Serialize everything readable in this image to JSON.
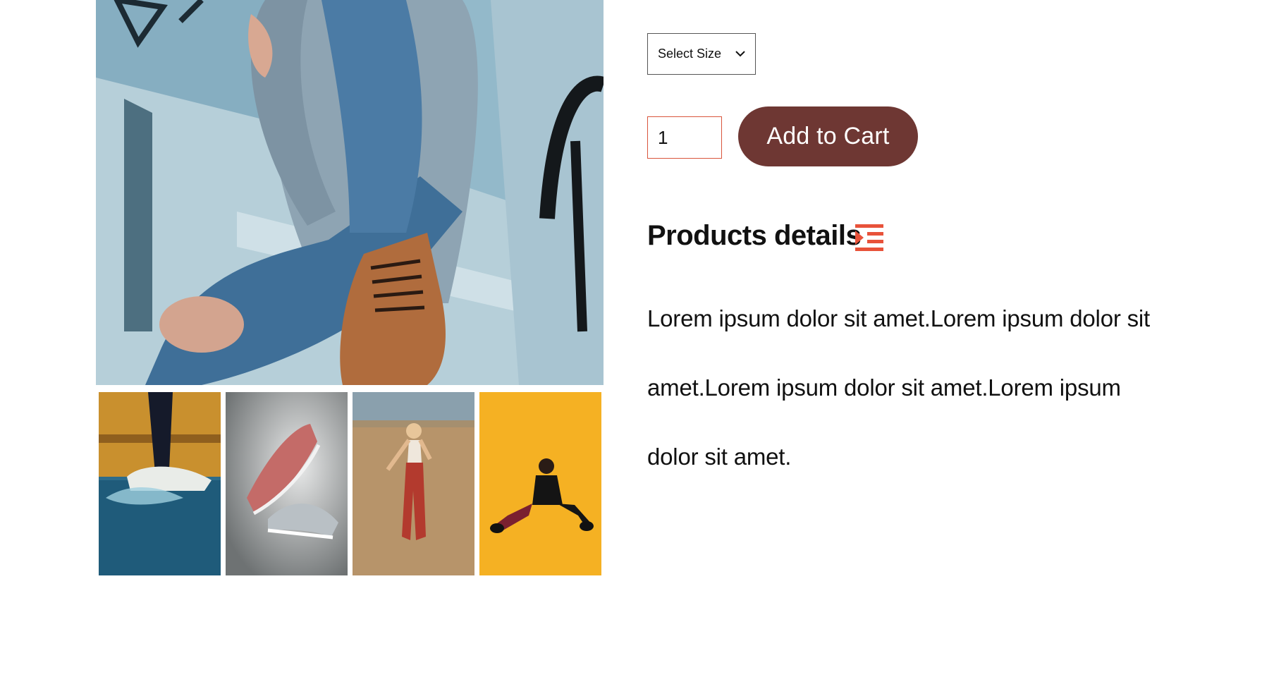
{
  "product": {
    "size_select": {
      "selected": "Select Size"
    },
    "quantity": {
      "value": "1"
    },
    "add_to_cart_label": "Add to Cart",
    "details_title": "Products details",
    "details_icon": "indent-list-icon",
    "description": "Lorem ipsum dolor sit amet.Lorem ipsum dolor sit amet.Lorem ipsum dolor sit amet.Lorem ipsum dolor sit amet."
  },
  "colors": {
    "accent": "#e8523a",
    "button": "#6e3733"
  },
  "gallery": {
    "main_image": "woman-sitting-jeans-boots-photo",
    "thumbnails": [
      {
        "icon": "sneakers-splash-photo"
      },
      {
        "icon": "pink-grey-sneakers-photo"
      },
      {
        "icon": "woman-walking-desert-photo"
      },
      {
        "icon": "woman-sitting-yellow-photo"
      }
    ]
  }
}
